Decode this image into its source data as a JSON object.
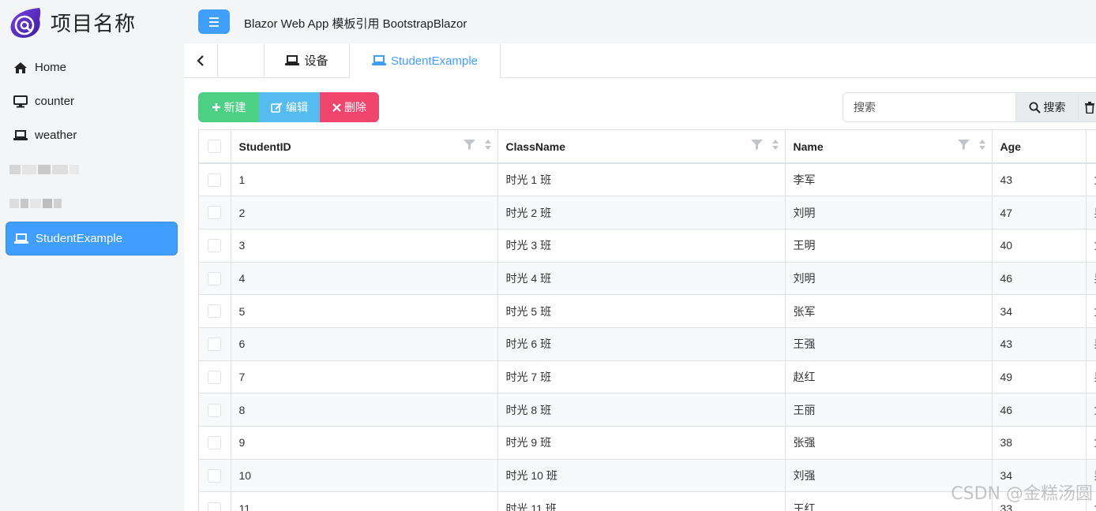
{
  "brand": {
    "title": "项目名称"
  },
  "sidebar": {
    "items": [
      {
        "label": "Home",
        "icon": "home-icon"
      },
      {
        "label": "counter",
        "icon": "monitor-icon"
      },
      {
        "label": "weather",
        "icon": "laptop-icon"
      }
    ],
    "active_item": {
      "label": "StudentExample",
      "icon": "laptop-icon"
    }
  },
  "header": {
    "title": "Blazor Web App 模板引用 BootstrapBlazor"
  },
  "tabs": [
    {
      "label": "设备",
      "icon": "laptop-icon"
    },
    {
      "label": "StudentExample",
      "icon": "laptop-icon",
      "active": true
    }
  ],
  "toolbar": {
    "new_label": "新建",
    "edit_label": "编辑",
    "delete_label": "删除"
  },
  "search": {
    "placeholder": "搜索",
    "button_label": "搜索"
  },
  "table": {
    "columns": [
      "StudentID",
      "ClassName",
      "Name",
      "Age"
    ],
    "rows": [
      [
        "1",
        "时光 1 班",
        "李军",
        "43",
        "女"
      ],
      [
        "2",
        "时光 2 班",
        "刘明",
        "47",
        "男"
      ],
      [
        "3",
        "时光 3 班",
        "王明",
        "40",
        "女"
      ],
      [
        "4",
        "时光 4 班",
        "刘明",
        "46",
        "男"
      ],
      [
        "5",
        "时光 5 班",
        "张军",
        "34",
        "女"
      ],
      [
        "6",
        "时光 6 班",
        "王强",
        "43",
        "男"
      ],
      [
        "7",
        "时光 7 班",
        "赵红",
        "49",
        "男"
      ],
      [
        "8",
        "时光 8 班",
        "王丽",
        "46",
        "女"
      ],
      [
        "9",
        "时光 9 班",
        "张强",
        "38",
        "女"
      ],
      [
        "10",
        "时光 10 班",
        "刘强",
        "34",
        "男"
      ],
      [
        "11",
        "时光 11 班",
        "王红",
        "33",
        "女"
      ]
    ]
  },
  "watermark": "CSDN @金糕汤圆",
  "colors": {
    "primary": "#409eff",
    "success": "#4cd083",
    "info": "#56bcf0",
    "danger": "#f0456d"
  }
}
